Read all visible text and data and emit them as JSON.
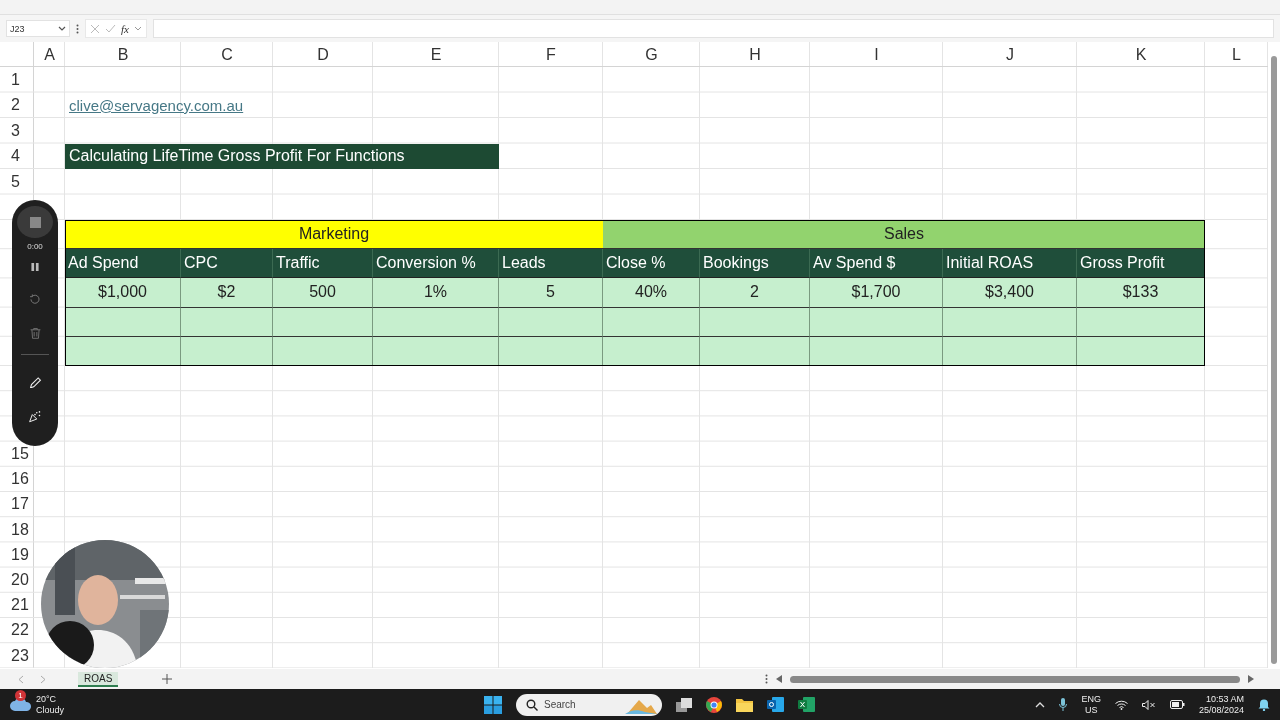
{
  "formula_bar": {
    "name_box": "J23",
    "function_label": "fx"
  },
  "columns": [
    "A",
    "B",
    "C",
    "D",
    "E",
    "F",
    "G",
    "H",
    "I",
    "J",
    "K",
    "L"
  ],
  "row_numbers": [
    "1",
    "2",
    "3",
    "4",
    "5",
    "15",
    "16",
    "17",
    "18",
    "19",
    "20",
    "21",
    "22",
    "23"
  ],
  "email": "clive@servagency.com.au",
  "sheet_title": "Calculating LifeTime Gross Profit For Functions",
  "table": {
    "groups": [
      {
        "label": "Marketing",
        "color": "#ffff00"
      },
      {
        "label": "Sales",
        "color": "#92d36e"
      }
    ],
    "headers": [
      "Ad Spend",
      "CPC",
      "Traffic",
      "Conversion %",
      "Leads",
      "Close %",
      "Bookings",
      "Av Spend $",
      "Initial ROAS",
      "Gross Profit"
    ],
    "values": [
      "$1,000",
      "$2",
      "500",
      "1%",
      "5",
      "40%",
      "2",
      "$1,700",
      "$3,400",
      "$133"
    ]
  },
  "recorder": {
    "timer": "0:00"
  },
  "sheet_tabs": [
    {
      "label": "ROAS",
      "selected": true
    }
  ],
  "taskbar": {
    "temperature": "20°C",
    "condition": "Cloudy",
    "badge": "1",
    "search_placeholder": "Search",
    "language": "ENG",
    "region": "US",
    "time": "10:53 AM",
    "date": "25/08/2024"
  }
}
